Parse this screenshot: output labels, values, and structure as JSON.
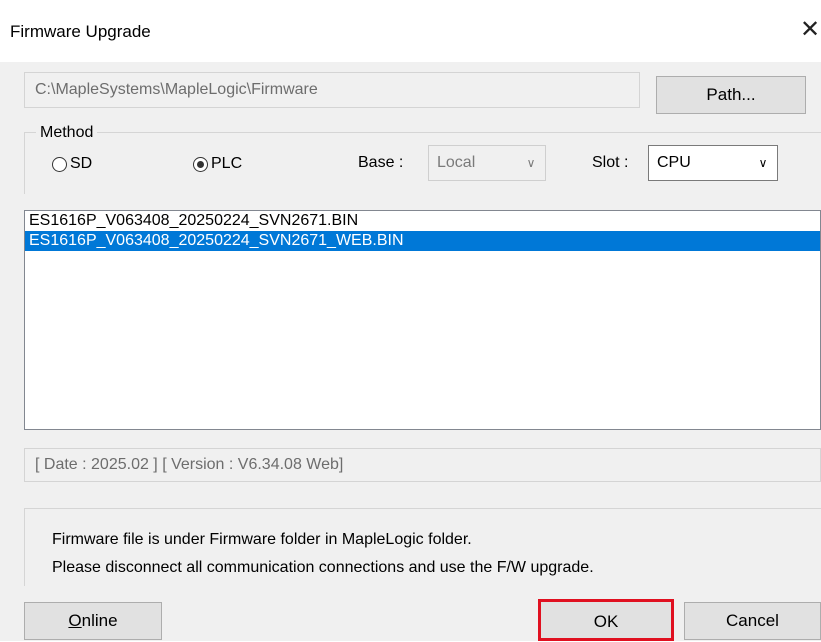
{
  "window": {
    "title": "Firmware Upgrade",
    "close_glyph": "✕"
  },
  "path": {
    "value": "C:\\MapleSystems\\MapleLogic\\Firmware",
    "button_label": "Path..."
  },
  "method": {
    "label": "Method",
    "options": [
      {
        "label": "SD",
        "selected": false
      },
      {
        "label": "PLC",
        "selected": true
      }
    ],
    "base_label": "Base :",
    "base_value": "Local",
    "slot_label": "Slot :",
    "slot_value": "CPU"
  },
  "files": [
    {
      "name": "ES1616P_V063408_20250224_SVN2671.BIN",
      "selected": false
    },
    {
      "name": "ES1616P_V063408_20250224_SVN2671_WEB.BIN",
      "selected": true
    }
  ],
  "info": "[ Date : 2025.02 ] [ Version : V6.34.08 Web]",
  "notes": [
    "Firmware file is under Firmware folder in MapleLogic folder.",
    "Please disconnect all communication connections and use the F/W upgrade."
  ],
  "buttons": {
    "online_mnemonic": "O",
    "online_rest": "nline",
    "ok": "OK",
    "cancel": "Cancel"
  },
  "colors": {
    "selection": "#0078d7",
    "highlight_box": "#e01020",
    "dialog_bg": "#f0f0f0"
  },
  "icons": {
    "close": "close-icon",
    "dropdown": "chevron-down-icon"
  }
}
